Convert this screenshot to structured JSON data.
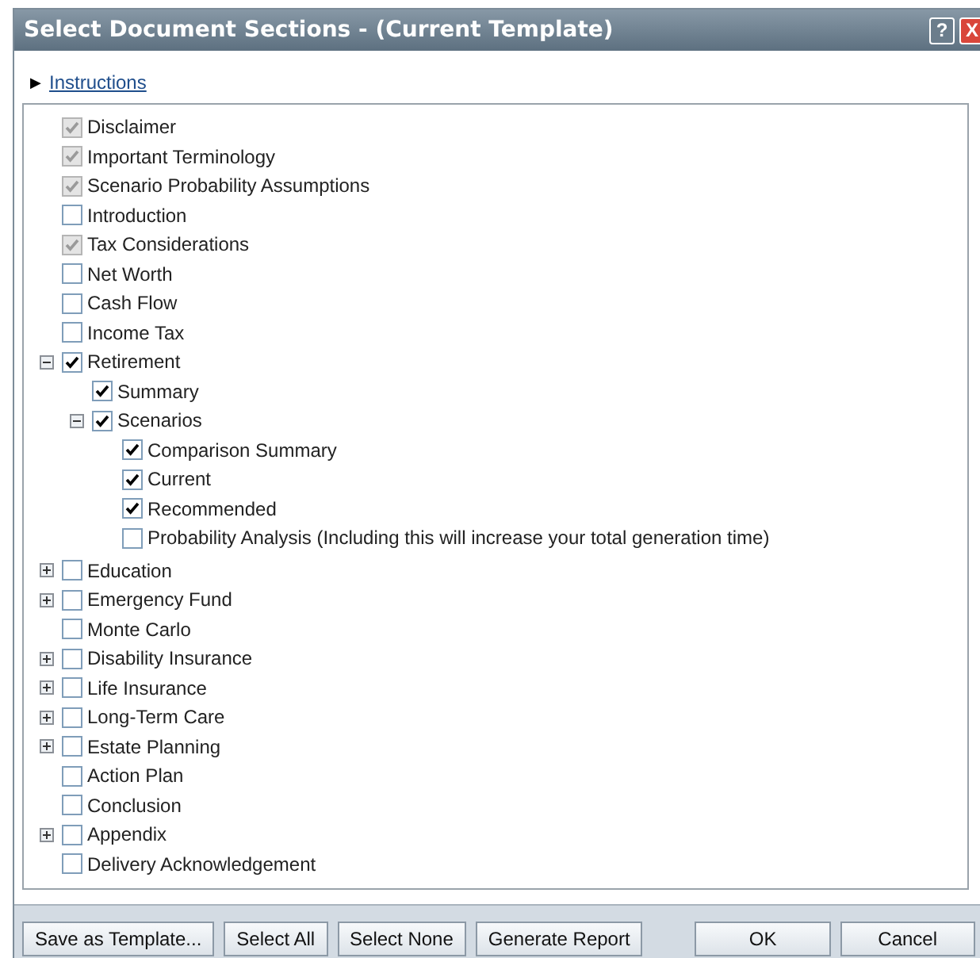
{
  "window": {
    "title": "Select Document Sections - (Current Template)",
    "help_button": "?",
    "close_button": "X"
  },
  "instructions": {
    "arrow": "▶",
    "link": "Instructions"
  },
  "sections": [
    {
      "label": "Disclaimer",
      "checked": true,
      "disabled": true
    },
    {
      "label": "Important Terminology",
      "checked": true,
      "disabled": true
    },
    {
      "label": "Scenario Probability Assumptions",
      "checked": true,
      "disabled": true
    },
    {
      "label": "Introduction",
      "checked": false,
      "disabled": false
    },
    {
      "label": "Tax Considerations",
      "checked": true,
      "disabled": true
    },
    {
      "label": "Net Worth",
      "checked": false,
      "disabled": false
    },
    {
      "label": "Cash Flow",
      "checked": false,
      "disabled": false
    },
    {
      "label": "Income Tax",
      "checked": false,
      "disabled": false
    },
    {
      "label": "Retirement",
      "checked": true,
      "disabled": false,
      "expanded": true,
      "children": [
        {
          "label": "Summary",
          "checked": true,
          "disabled": false
        },
        {
          "label": "Scenarios",
          "checked": true,
          "disabled": false,
          "expanded": true,
          "children": [
            {
              "label": "Comparison Summary",
              "checked": true,
              "disabled": false
            },
            {
              "label": "Current",
              "checked": true,
              "disabled": false
            },
            {
              "label": "Recommended",
              "checked": true,
              "disabled": false
            },
            {
              "label": "Probability Analysis (Including this will increase your total generation time)",
              "checked": false,
              "disabled": false
            }
          ]
        }
      ]
    },
    {
      "label": "Education",
      "checked": false,
      "disabled": false,
      "expanded": false
    },
    {
      "label": "Emergency Fund",
      "checked": false,
      "disabled": false,
      "expanded": false
    },
    {
      "label": "Monte Carlo",
      "checked": false,
      "disabled": false
    },
    {
      "label": "Disability Insurance",
      "checked": false,
      "disabled": false,
      "expanded": false
    },
    {
      "label": "Life Insurance",
      "checked": false,
      "disabled": false,
      "expanded": false
    },
    {
      "label": "Long-Term Care",
      "checked": false,
      "disabled": false,
      "expanded": false
    },
    {
      "label": "Estate Planning",
      "checked": false,
      "disabled": false,
      "expanded": false
    },
    {
      "label": "Action Plan",
      "checked": false,
      "disabled": false
    },
    {
      "label": "Conclusion",
      "checked": false,
      "disabled": false
    },
    {
      "label": "Appendix",
      "checked": false,
      "disabled": false,
      "expanded": false
    },
    {
      "label": "Delivery Acknowledgement",
      "checked": false,
      "disabled": false
    }
  ],
  "buttons_left": [
    "Save as Template...",
    "Select All",
    "Select None",
    "Generate Report"
  ],
  "buttons_right": [
    "OK",
    "Cancel"
  ]
}
